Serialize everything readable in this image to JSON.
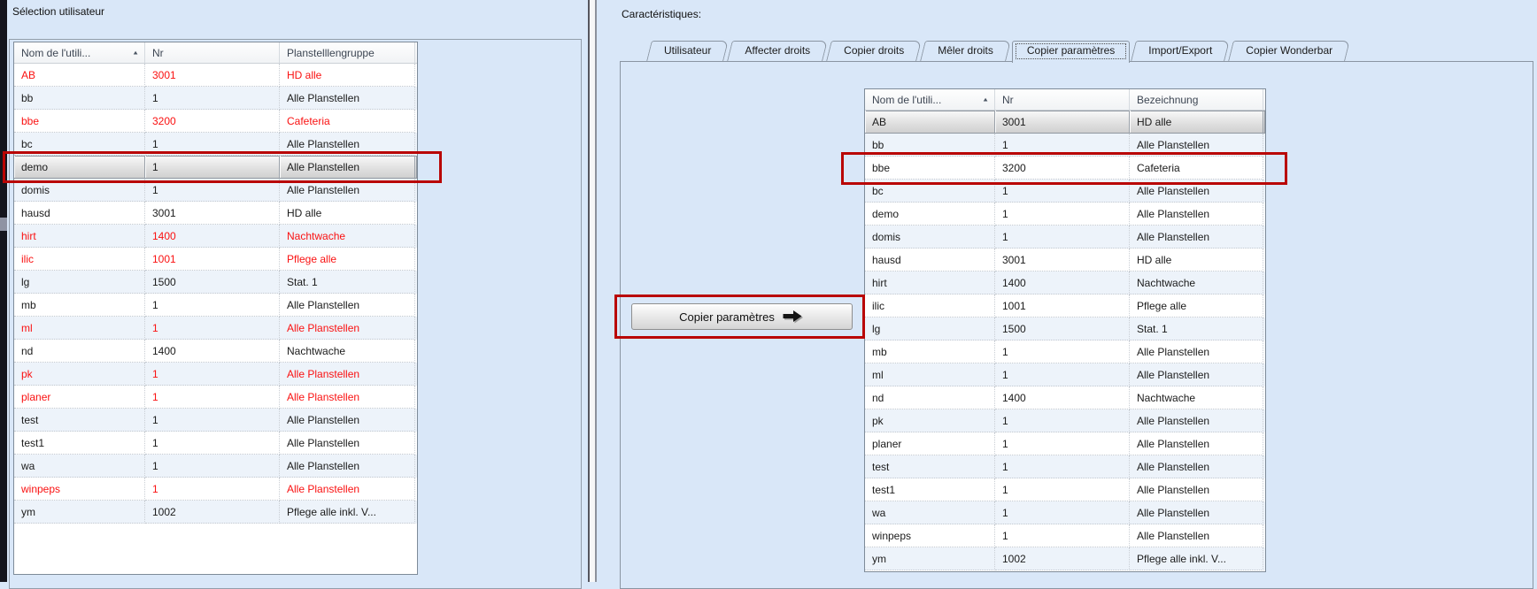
{
  "colors": {
    "annotation_red": "#b90504",
    "red_text": "#fa1111",
    "form_background": "#d9e7f8",
    "selection_gray": "#d8d8d8"
  },
  "left_panel": {
    "title": "Sélection utilisateur",
    "table": {
      "columns": [
        {
          "label": "Nom de l'utili...",
          "sort": "asc"
        },
        {
          "label": "Nr"
        },
        {
          "label": "Planstelllengruppe"
        }
      ],
      "rows": [
        {
          "cells": [
            "AB",
            "3001",
            "HD alle"
          ],
          "text_color": "red"
        },
        {
          "cells": [
            "bb",
            "1",
            "Alle Planstellen"
          ],
          "text_color": "black"
        },
        {
          "cells": [
            "bbe",
            "3200",
            "Cafeteria"
          ],
          "text_color": "red"
        },
        {
          "cells": [
            "bc",
            "1",
            "Alle Planstellen"
          ],
          "text_color": "black"
        },
        {
          "cells": [
            "demo",
            "1",
            "Alle Planstellen"
          ],
          "text_color": "black",
          "selected": true,
          "outlined": true
        },
        {
          "cells": [
            "domis",
            "1",
            "Alle Planstellen"
          ],
          "text_color": "black"
        },
        {
          "cells": [
            "hausd",
            "3001",
            "HD alle"
          ],
          "text_color": "black"
        },
        {
          "cells": [
            "hirt",
            "1400",
            "Nachtwache"
          ],
          "text_color": "red"
        },
        {
          "cells": [
            "ilic",
            "1001",
            "Pflege alle"
          ],
          "text_color": "red"
        },
        {
          "cells": [
            "lg",
            "1500",
            "Stat. 1"
          ],
          "text_color": "black"
        },
        {
          "cells": [
            "mb",
            "1",
            "Alle Planstellen"
          ],
          "text_color": "black"
        },
        {
          "cells": [
            "ml",
            "1",
            "Alle Planstellen"
          ],
          "text_color": "red"
        },
        {
          "cells": [
            "nd",
            "1400",
            "Nachtwache"
          ],
          "text_color": "black"
        },
        {
          "cells": [
            "pk",
            "1",
            "Alle Planstellen"
          ],
          "text_color": "red"
        },
        {
          "cells": [
            "planer",
            "1",
            "Alle Planstellen"
          ],
          "text_color": "red"
        },
        {
          "cells": [
            "test",
            "1",
            "Alle Planstellen"
          ],
          "text_color": "black"
        },
        {
          "cells": [
            "test1",
            "1",
            "Alle Planstellen"
          ],
          "text_color": "black"
        },
        {
          "cells": [
            "wa",
            "1",
            "Alle Planstellen"
          ],
          "text_color": "black"
        },
        {
          "cells": [
            "winpeps",
            "1",
            "Alle Planstellen"
          ],
          "text_color": "red"
        },
        {
          "cells": [
            "ym",
            "1002",
            "Pflege alle inkl. V..."
          ],
          "text_color": "black"
        }
      ]
    }
  },
  "right_panel": {
    "title": "Caractéristiques:",
    "tabs": {
      "active_index": 4,
      "items": [
        {
          "label": "Utilisateur"
        },
        {
          "label": "Affecter droits"
        },
        {
          "label": "Copier droits"
        },
        {
          "label": "Mêler droits"
        },
        {
          "label": "Copier paramètres"
        },
        {
          "label": "Import/Export"
        },
        {
          "label": "Copier Wonderbar"
        }
      ]
    },
    "copy_button": {
      "label": "Copier paramètres",
      "icon": "arrow-right-icon"
    },
    "table": {
      "columns": [
        {
          "label": "Nom de l'utili...",
          "sort": "asc"
        },
        {
          "label": "Nr"
        },
        {
          "label": "Bezeichnung"
        }
      ],
      "rows": [
        {
          "cells": [
            "AB",
            "3001",
            "HD alle"
          ],
          "text_color": "black",
          "selected": true
        },
        {
          "cells": [
            "bb",
            "1",
            "Alle Planstellen"
          ],
          "text_color": "black"
        },
        {
          "cells": [
            "bbe",
            "3200",
            "Cafeteria"
          ],
          "text_color": "black",
          "outlined": true
        },
        {
          "cells": [
            "bc",
            "1",
            "Alle Planstellen"
          ],
          "text_color": "black"
        },
        {
          "cells": [
            "demo",
            "1",
            "Alle Planstellen"
          ],
          "text_color": "black"
        },
        {
          "cells": [
            "domis",
            "1",
            "Alle Planstellen"
          ],
          "text_color": "black"
        },
        {
          "cells": [
            "hausd",
            "3001",
            "HD alle"
          ],
          "text_color": "black"
        },
        {
          "cells": [
            "hirt",
            "1400",
            "Nachtwache"
          ],
          "text_color": "black"
        },
        {
          "cells": [
            "ilic",
            "1001",
            "Pflege alle"
          ],
          "text_color": "black"
        },
        {
          "cells": [
            "lg",
            "1500",
            "Stat. 1"
          ],
          "text_color": "black"
        },
        {
          "cells": [
            "mb",
            "1",
            "Alle Planstellen"
          ],
          "text_color": "black"
        },
        {
          "cells": [
            "ml",
            "1",
            "Alle Planstellen"
          ],
          "text_color": "black"
        },
        {
          "cells": [
            "nd",
            "1400",
            "Nachtwache"
          ],
          "text_color": "black"
        },
        {
          "cells": [
            "pk",
            "1",
            "Alle Planstellen"
          ],
          "text_color": "black"
        },
        {
          "cells": [
            "planer",
            "1",
            "Alle Planstellen"
          ],
          "text_color": "black"
        },
        {
          "cells": [
            "test",
            "1",
            "Alle Planstellen"
          ],
          "text_color": "black"
        },
        {
          "cells": [
            "test1",
            "1",
            "Alle Planstellen"
          ],
          "text_color": "black"
        },
        {
          "cells": [
            "wa",
            "1",
            "Alle Planstellen"
          ],
          "text_color": "black"
        },
        {
          "cells": [
            "winpeps",
            "1",
            "Alle Planstellen"
          ],
          "text_color": "black"
        },
        {
          "cells": [
            "ym",
            "1002",
            "Pflege alle inkl. V..."
          ],
          "text_color": "black"
        }
      ]
    }
  }
}
